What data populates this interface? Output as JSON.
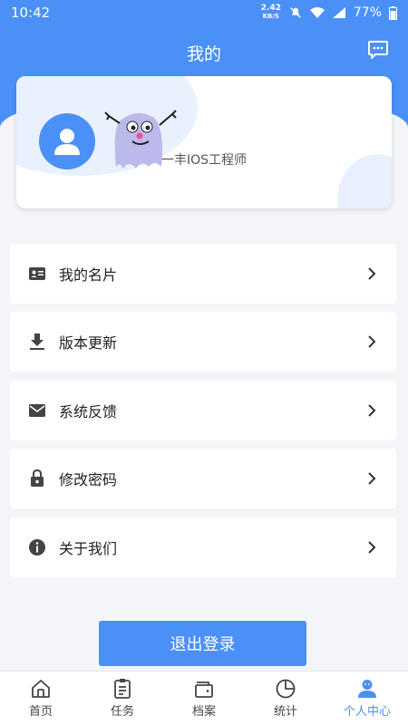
{
  "status_bar": {
    "time": "10:42",
    "net_speed_value": "2.42",
    "net_speed_unit": "KB/S",
    "battery": "77%"
  },
  "header": {
    "title": "我的"
  },
  "profile": {
    "role": "一丰IOS工程师"
  },
  "menu": [
    {
      "label": "我的名片",
      "icon": "id-card-icon"
    },
    {
      "label": "版本更新",
      "icon": "download-icon"
    },
    {
      "label": "系统反馈",
      "icon": "mail-icon"
    },
    {
      "label": "修改密码",
      "icon": "lock-icon"
    },
    {
      "label": "关于我们",
      "icon": "info-icon"
    }
  ],
  "logout_label": "退出登录",
  "tabs": [
    {
      "label": "首页",
      "icon": "home-icon"
    },
    {
      "label": "任务",
      "icon": "clipboard-icon"
    },
    {
      "label": "档案",
      "icon": "wallet-icon"
    },
    {
      "label": "统计",
      "icon": "pie-chart-icon"
    },
    {
      "label": "个人中心",
      "icon": "person-icon",
      "active": true
    }
  ],
  "colors": {
    "accent": "#4a90f6",
    "background": "#f4f5f8"
  }
}
